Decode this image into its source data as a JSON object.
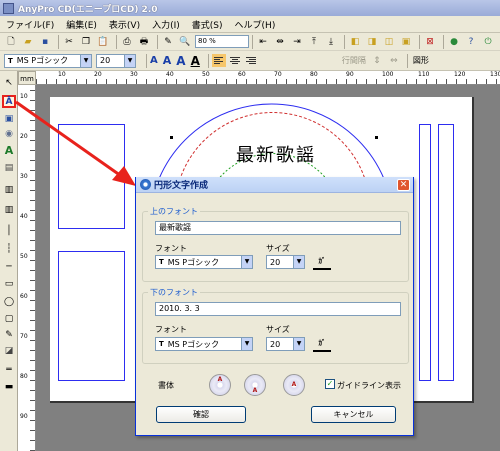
{
  "window": {
    "title": "AnyPro CD(エニープロCD) 2.0"
  },
  "menu": [
    "ファイル(F)",
    "編集(E)",
    "表示(V)",
    "入力(I)",
    "書式(S)",
    "ヘルプ(H)"
  ],
  "toolbar": {
    "zoom": "80 %",
    "font_name": "MS Pゴシック",
    "font_size": "20",
    "font_style_a1": "A",
    "font_style_a2": "A",
    "font_style_a3": "A",
    "font_style_a4": "A",
    "char_spacing_label": "行間隔",
    "shape_label": "図形"
  },
  "ruler": {
    "unit": "mm",
    "marks": [
      "10",
      "20",
      "30",
      "40",
      "50",
      "60",
      "70",
      "80",
      "90",
      "100",
      "110",
      "120",
      "130"
    ]
  },
  "canvas": {
    "arc_text": "最新歌謡"
  },
  "dialog": {
    "title": "円形文字作成",
    "close": "✕",
    "top_group": {
      "legend": "上のフォント",
      "text": "最新歌謡",
      "font_label": "フォント",
      "font_value": "MS Pゴシック",
      "size_label": "サイズ",
      "size_value": "20"
    },
    "bottom_group": {
      "legend": "下のフォント",
      "text": "2010. 3. 3",
      "font_label": "フォント",
      "font_value": "MS Pゴシック",
      "size_label": "サイズ",
      "size_value": "20"
    },
    "style_label": "書体",
    "guideline_label": "ガイドライン表示",
    "guideline_checked": true,
    "ok_label": "確認",
    "cancel_label": "キャンセル"
  },
  "colors": {
    "highlight": "#e8221c",
    "guide_blue": "#2d2df0",
    "dialog_border": "#0831d9"
  }
}
